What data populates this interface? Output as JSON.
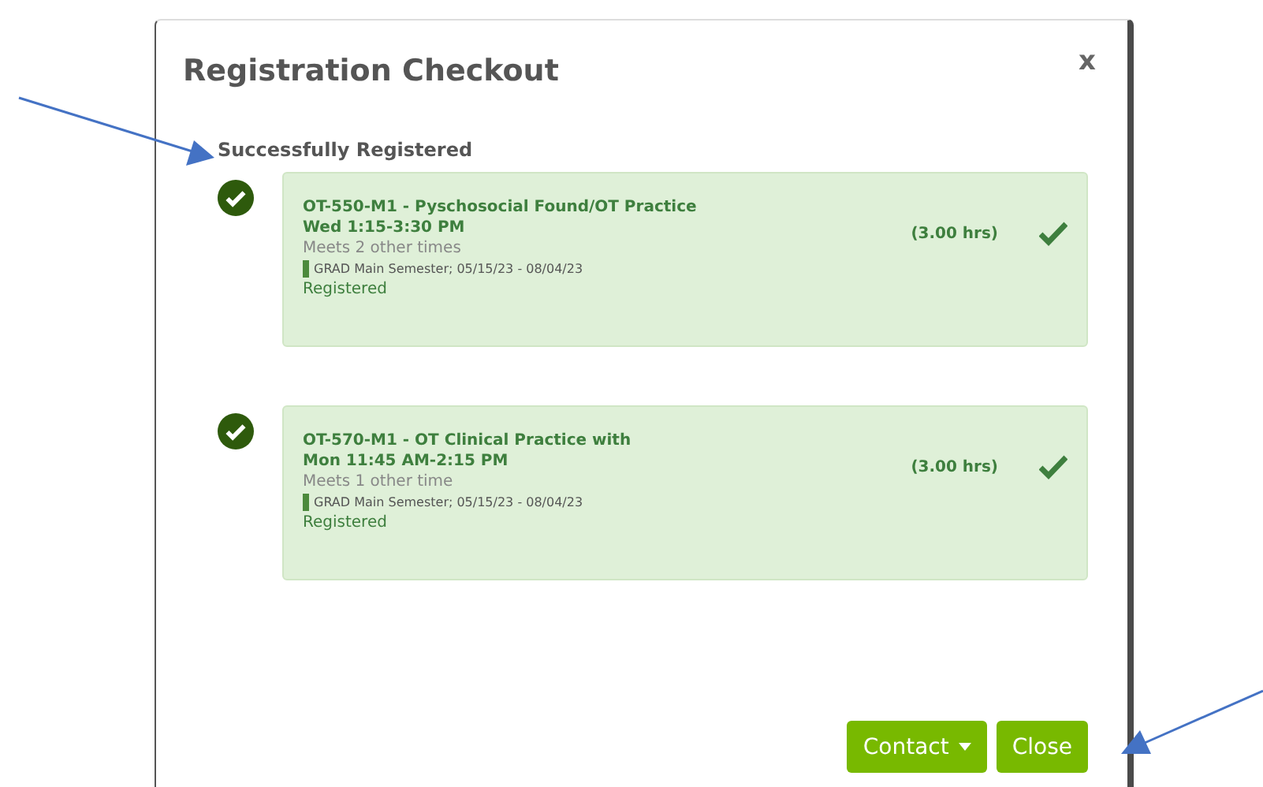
{
  "dialog": {
    "title": "Registration Checkout",
    "close_label": "x",
    "section_title": "Successfully Registered",
    "registrations": [
      {
        "course": "OT-550-M1 - Pyschosocial Found/OT Practice",
        "schedule": "Wed 1:15-3:30 PM",
        "meetings": "Meets 2 other times",
        "term": "GRAD Main Semester; 05/15/23 - 08/04/23",
        "status": "Registered",
        "hours": "(3.00 hrs)"
      },
      {
        "course": "OT-570-M1 - OT Clinical Practice with",
        "schedule": "Mon 11:45 AM-2:15 PM",
        "meetings": "Meets 1 other time",
        "term": "GRAD Main Semester; 05/15/23 - 08/04/23",
        "status": "Registered",
        "hours": "(3.00 hrs)"
      }
    ],
    "buttons": [
      {
        "label": "Contact",
        "kind": "dropdown"
      },
      {
        "label": "Close",
        "kind": "plain"
      }
    ]
  }
}
